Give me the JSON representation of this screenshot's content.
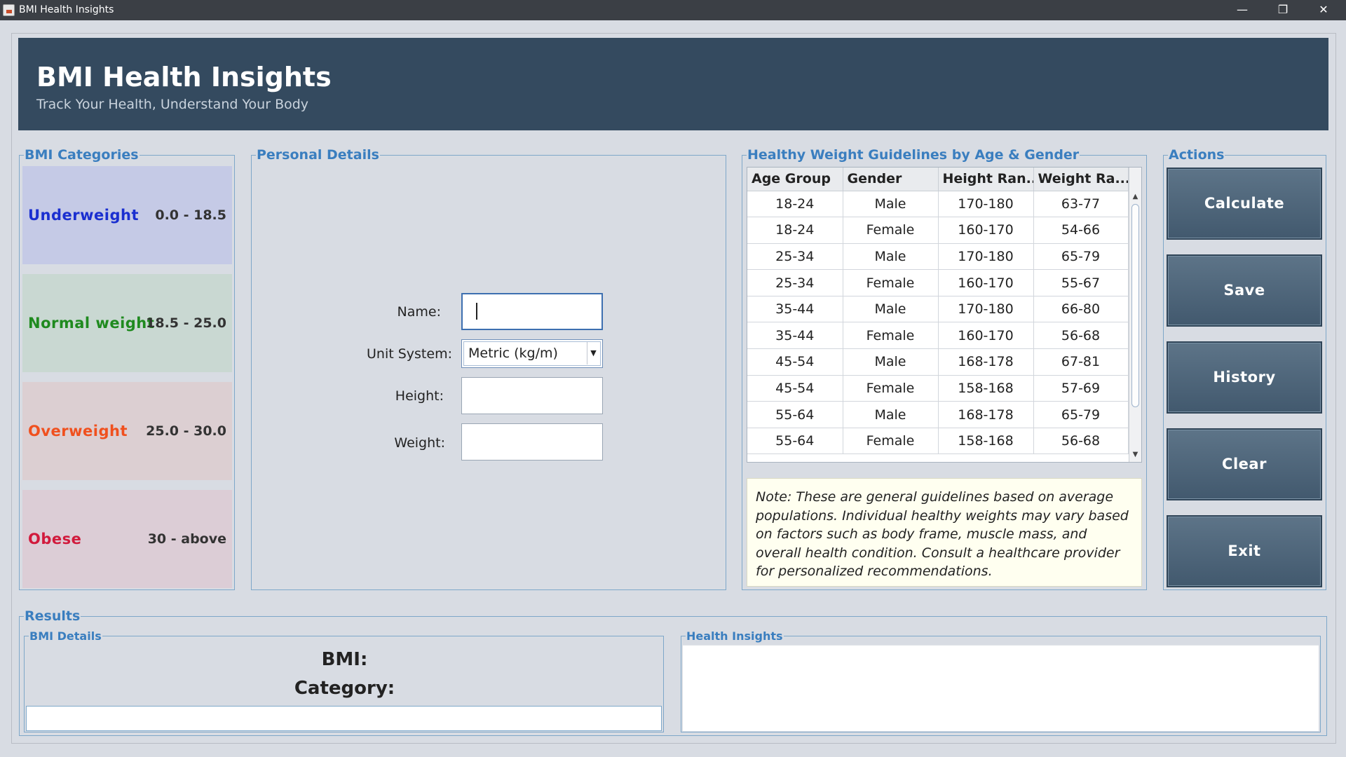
{
  "window": {
    "title": "BMI Health Insights",
    "controls": {
      "minimize": "—",
      "restore": "❐",
      "close": "✕"
    }
  },
  "header": {
    "title": "BMI Health Insights",
    "subtitle": "Track Your Health, Understand Your Body"
  },
  "categories": {
    "label": "BMI Categories",
    "items": [
      {
        "name": "Underweight",
        "range": "0.0 - 18.5",
        "color": "#1a2fd0",
        "bg": "#c5cae6"
      },
      {
        "name": "Normal weight",
        "range": "18.5 - 25.0",
        "color": "#1f8a1f",
        "bg": "#c9d8d2"
      },
      {
        "name": "Overweight",
        "range": "25.0 - 30.0",
        "color": "#f0501e",
        "bg": "#dccfd2"
      },
      {
        "name": "Obese",
        "range": "30 - above",
        "color": "#d11a3c",
        "bg": "#dccdd6"
      }
    ]
  },
  "personal": {
    "label": "Personal Details",
    "name_label": "Name:",
    "name_value": "",
    "unit_label": "Unit System:",
    "unit_value": "Metric (kg/m)",
    "height_label": "Height:",
    "height_value": "",
    "weight_label": "Weight:",
    "weight_value": ""
  },
  "guidelines": {
    "label": "Healthy Weight Guidelines by Age & Gender",
    "columns": [
      "Age Group",
      "Gender",
      "Height Ran...",
      "Weight Ra..."
    ],
    "rows": [
      [
        "18-24",
        "Male",
        "170-180",
        "63-77"
      ],
      [
        "18-24",
        "Female",
        "160-170",
        "54-66"
      ],
      [
        "25-34",
        "Male",
        "170-180",
        "65-79"
      ],
      [
        "25-34",
        "Female",
        "160-170",
        "55-67"
      ],
      [
        "35-44",
        "Male",
        "170-180",
        "66-80"
      ],
      [
        "35-44",
        "Female",
        "160-170",
        "56-68"
      ],
      [
        "45-54",
        "Male",
        "168-178",
        "67-81"
      ],
      [
        "45-54",
        "Female",
        "158-168",
        "57-69"
      ],
      [
        "55-64",
        "Male",
        "168-178",
        "65-79"
      ],
      [
        "55-64",
        "Female",
        "158-168",
        "56-68"
      ]
    ],
    "note": "Note: These are general guidelines based on average populations. Individual healthy weights may vary based on factors such as body frame, muscle mass, and overall health condition. Consult a healthcare provider for personalized recommendations."
  },
  "actions": {
    "label": "Actions",
    "buttons": [
      "Calculate",
      "Save",
      "History",
      "Clear",
      "Exit"
    ]
  },
  "results": {
    "label": "Results",
    "bmi_details_label": "BMI Details",
    "bmi_label": "BMI:",
    "category_label": "Category:",
    "health_insights_label": "Health Insights"
  }
}
